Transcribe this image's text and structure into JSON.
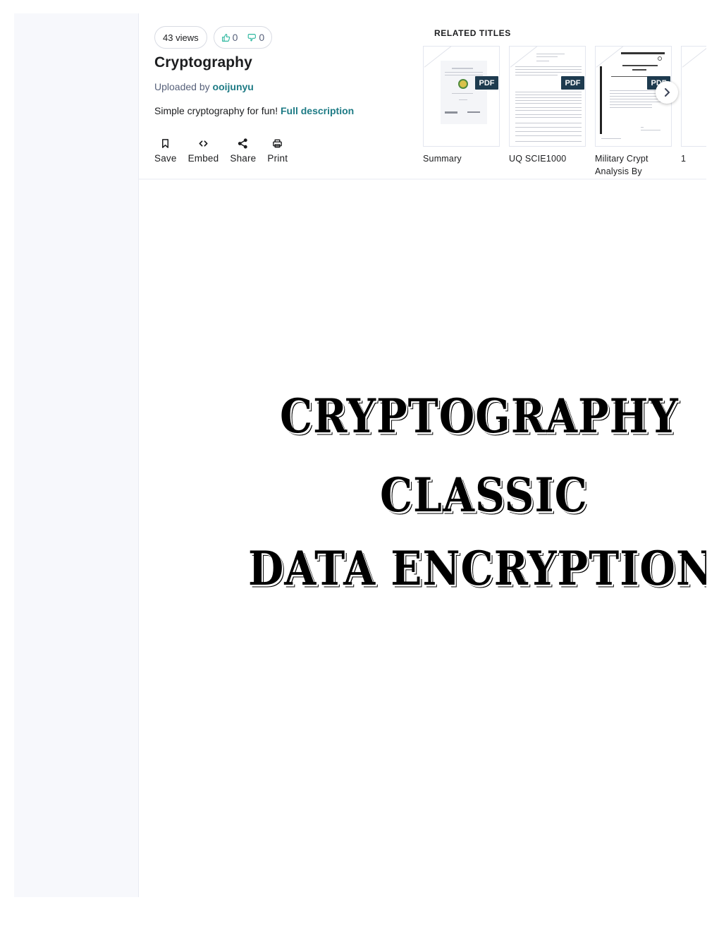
{
  "stats": {
    "views": "43 views",
    "likes": "0",
    "dislikes": "0"
  },
  "document": {
    "title": "Cryptography",
    "uploaded_by_prefix": "Uploaded by ",
    "uploader": "ooijunyu",
    "description": "Simple cryptography for fun!",
    "full_description_link": "Full description"
  },
  "actions": [
    {
      "label": "Save",
      "icon": "bookmark-icon"
    },
    {
      "label": "Embed",
      "icon": "code-icon"
    },
    {
      "label": "Share",
      "icon": "share-icon"
    },
    {
      "label": "Print",
      "icon": "printer-icon"
    }
  ],
  "related": {
    "heading": "RELATED TITLES",
    "items": [
      {
        "title": "Summary",
        "badge": "PDF"
      },
      {
        "title": "UQ SCIE1000",
        "badge": "PDF"
      },
      {
        "title": "Military Crypt Analysis By",
        "badge": "PDF"
      },
      {
        "title": "1",
        "badge": ""
      }
    ],
    "next_icon": "chevron-right-icon"
  },
  "page_content": {
    "line1": "CRYPTOGRAPHY",
    "line2": "CLASSIC",
    "line3": "DATA ENCRYPTION"
  },
  "colors": {
    "accent": "#1e7b85",
    "like_icon": "#2fb8a0",
    "pdf_badge": "#1e3b4f",
    "sidebar_bg": "#f7f8fc"
  }
}
